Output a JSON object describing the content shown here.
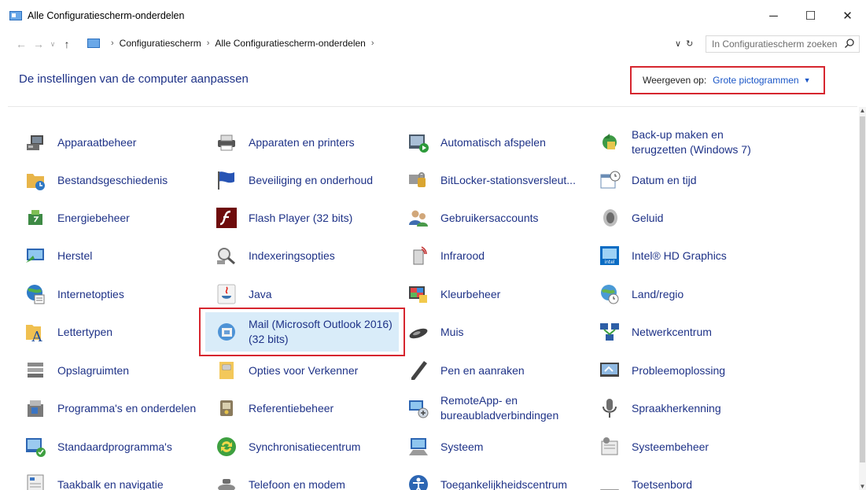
{
  "window": {
    "title": "Alle Configuratiescherm-onderdelen",
    "controls": {
      "minimize": "─",
      "maximize": "☐",
      "close": "✕"
    }
  },
  "address": {
    "breadcrumb": [
      "Configuratiescherm",
      "Alle Configuratiescherm-onderdelen"
    ],
    "search_placeholder": "In Configuratiescherm zoeken"
  },
  "header": {
    "title": "De instellingen van de computer aanpassen",
    "view_label": "Weergeven op:",
    "view_value": "Grote pictogrammen"
  },
  "items": [
    {
      "label": "Apparaatbeheer",
      "icon": "device-manager-icon"
    },
    {
      "label": "Apparaten en printers",
      "icon": "printer-icon"
    },
    {
      "label": "Automatisch afspelen",
      "icon": "autoplay-icon"
    },
    {
      "label": "Back-up maken en terugzetten (Windows 7)",
      "icon": "backup-icon"
    },
    {
      "label": "Bestandsgeschiedenis",
      "icon": "file-history-icon"
    },
    {
      "label": "Beveiliging en onderhoud",
      "icon": "flag-icon"
    },
    {
      "label": "BitLocker-stationsversleut...",
      "icon": "bitlocker-icon"
    },
    {
      "label": "Datum en tijd",
      "icon": "calendar-clock-icon"
    },
    {
      "label": "Energiebeheer",
      "icon": "power-icon"
    },
    {
      "label": "Flash Player (32 bits)",
      "icon": "flash-icon"
    },
    {
      "label": "Gebruikersaccounts",
      "icon": "users-icon"
    },
    {
      "label": "Geluid",
      "icon": "speaker-icon"
    },
    {
      "label": "Herstel",
      "icon": "recovery-icon"
    },
    {
      "label": "Indexeringsopties",
      "icon": "indexing-icon"
    },
    {
      "label": "Infrarood",
      "icon": "infrared-icon"
    },
    {
      "label": "Intel® HD Graphics",
      "icon": "intel-graphics-icon"
    },
    {
      "label": "Internetopties",
      "icon": "internet-options-icon"
    },
    {
      "label": "Java",
      "icon": "java-icon"
    },
    {
      "label": "Kleurbeheer",
      "icon": "color-management-icon"
    },
    {
      "label": "Land/regio",
      "icon": "globe-clock-icon"
    },
    {
      "label": "Lettertypen",
      "icon": "fonts-icon"
    },
    {
      "label": "Mail (Microsoft Outlook 2016) (32 bits)",
      "icon": "mail-icon"
    },
    {
      "label": "Muis",
      "icon": "mouse-icon"
    },
    {
      "label": "Netwerkcentrum",
      "icon": "network-icon"
    },
    {
      "label": "Opslagruimten",
      "icon": "storage-icon"
    },
    {
      "label": "Opties voor Verkenner",
      "icon": "folder-options-icon"
    },
    {
      "label": "Pen en aanraken",
      "icon": "pen-icon"
    },
    {
      "label": "Probleemoplossing",
      "icon": "troubleshoot-icon"
    },
    {
      "label": "Programma's en onderdelen",
      "icon": "programs-icon"
    },
    {
      "label": "Referentiebeheer",
      "icon": "credential-icon"
    },
    {
      "label": "RemoteApp- en bureaubladverbindingen",
      "icon": "remote-desktop-icon"
    },
    {
      "label": "Spraakherkenning",
      "icon": "microphone-icon"
    },
    {
      "label": "Standaardprogramma's",
      "icon": "default-programs-icon"
    },
    {
      "label": "Synchronisatiecentrum",
      "icon": "sync-icon"
    },
    {
      "label": "Systeem",
      "icon": "system-icon"
    },
    {
      "label": "Systeembeheer",
      "icon": "admin-tools-icon"
    },
    {
      "label": "Taakbalk en navigatie",
      "icon": "taskbar-icon"
    },
    {
      "label": "Telefoon en modem",
      "icon": "phone-icon"
    },
    {
      "label": "Toegankelijkheidscentrum",
      "icon": "accessibility-icon"
    },
    {
      "label": "Toetsenbord",
      "icon": "keyboard-icon"
    }
  ],
  "highlighted_item": "Mail (Microsoft Outlook 2016) (32 bits)",
  "colors": {
    "link": "#1e3287",
    "highlight_border": "#d6262f",
    "selection": "#d9ecf9"
  }
}
